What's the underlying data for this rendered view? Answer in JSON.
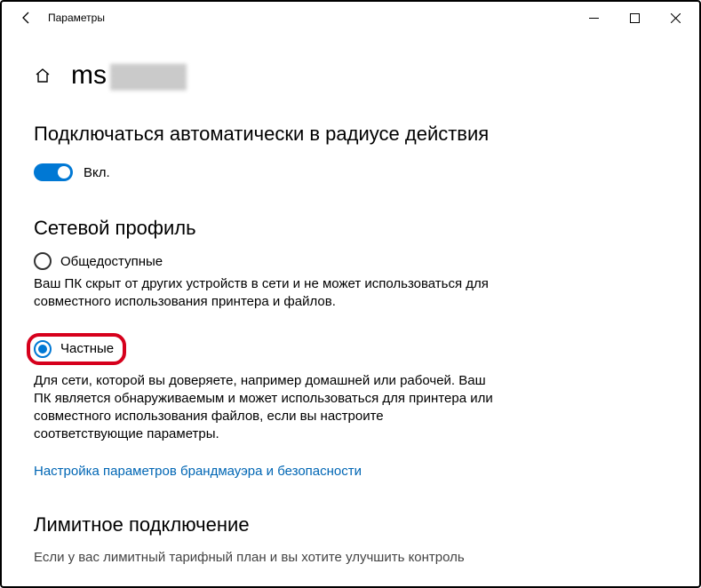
{
  "window": {
    "title": "Параметры"
  },
  "page": {
    "title_prefix": "ms",
    "autoconnect": {
      "heading": "Подключаться автоматически в радиусе действия",
      "toggle_label": "Вкл."
    },
    "profile": {
      "heading": "Сетевой профиль",
      "public_label": "Общедоступные",
      "public_desc": "Ваш ПК скрыт от других устройств в сети и не может использоваться для совместного использования принтера и файлов.",
      "private_label": "Частные",
      "private_desc": "Для сети, которой вы доверяете, например домашней или рабочей. Ваш ПК является обнаруживаемым и может использоваться для принтера или совместного использования файлов, если вы настроите соответствующие параметры.",
      "firewall_link": "Настройка параметров брандмауэра и безопасности"
    },
    "metered": {
      "heading": "Лимитное подключение",
      "desc_cut": "Если у вас лимитный тарифный план и вы хотите улучшить контроль"
    }
  },
  "colors": {
    "accent": "#0078d4",
    "link": "#0066b4",
    "highlight": "#d6001c"
  }
}
